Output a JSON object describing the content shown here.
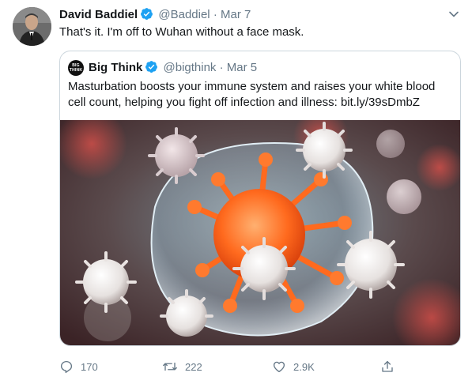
{
  "tweet": {
    "author_name": "David Baddiel",
    "author_handle": "@Baddiel",
    "separator": "·",
    "date": "Mar 7",
    "text": "That's it. I'm off to Wuhan without a face mask."
  },
  "quoted_tweet": {
    "avatar_text": "BIG THINK",
    "author_name": "Big Think",
    "author_handle": "@bigthink",
    "separator": "·",
    "date": "Mar 5",
    "text": "Masturbation boosts your immune system and raises your white blood cell count, helping you fight off infection and illness: bit.ly/39sDmbZ"
  },
  "actions": {
    "reply_count": "170",
    "retweet_count": "222",
    "like_count": "2.9K"
  },
  "icons": {
    "verified": "verified-badge-icon",
    "more": "chevron-down-icon",
    "reply": "reply-icon",
    "retweet": "retweet-icon",
    "like": "heart-icon",
    "share": "share-icon"
  },
  "colors": {
    "text": "#14171a",
    "secondary": "#657786",
    "verified_blue": "#1da1f2",
    "border": "#ccd6dd"
  }
}
